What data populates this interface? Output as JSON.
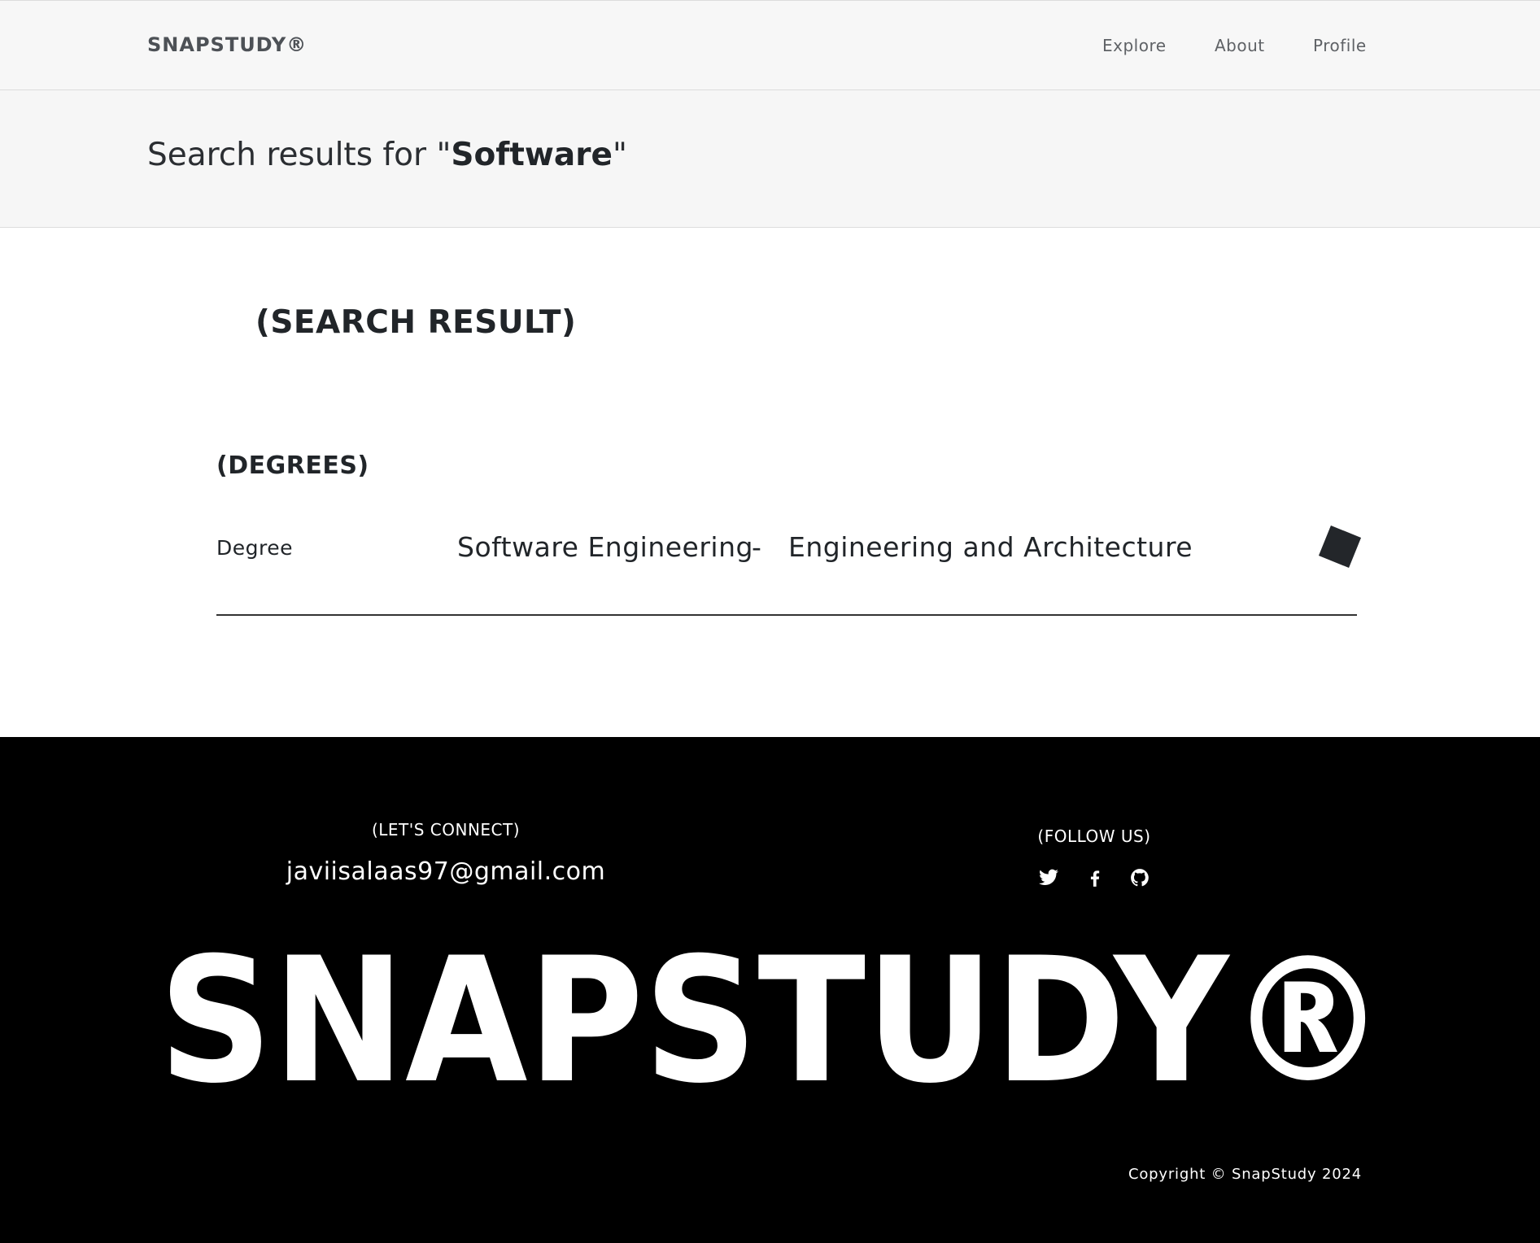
{
  "navbar": {
    "brand": "SNAPSTUDY®",
    "links": [
      {
        "label": "Explore"
      },
      {
        "label": "About"
      },
      {
        "label": "Profile"
      }
    ]
  },
  "search": {
    "prefix": "Search results for \"",
    "query": "Software",
    "suffix": "\""
  },
  "results": {
    "heading": "(SEARCH RESULT)",
    "sections": [
      {
        "heading": "(DEGREES)",
        "rows": [
          {
            "type_label": "Degree",
            "name": "Software Engineering",
            "separator": "-",
            "faculty": "Engineering and Architecture",
            "action_icon": "arrow-icon"
          }
        ]
      }
    ]
  },
  "footer": {
    "connect_label": "(LET'S CONNECT)",
    "email": "javiisalaas97@gmail.com",
    "follow_label": "(FOLLOW US)",
    "socials": [
      {
        "icon": "twitter-icon"
      },
      {
        "icon": "facebook-icon"
      },
      {
        "icon": "github-icon"
      }
    ],
    "big_logo": "SNAPSTUDY®",
    "copyright": "Copyright © SnapStudy 2024"
  },
  "colors": {
    "navbar_bg": "#f7f7f7",
    "text": "#212529",
    "footer_bg": "#000000",
    "footer_text": "#ffffff"
  }
}
